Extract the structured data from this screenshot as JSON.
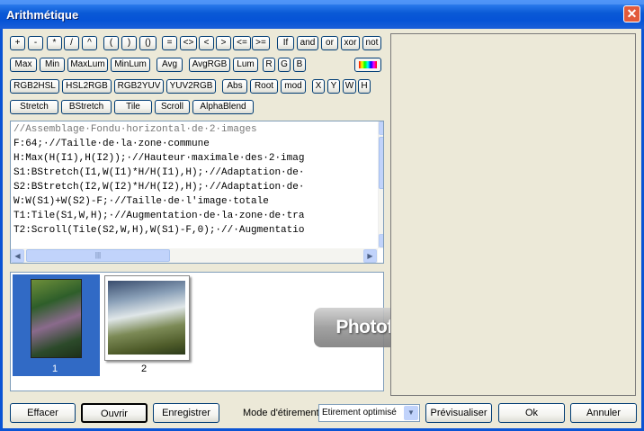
{
  "window": {
    "title": "Arithmétique",
    "close_glyph": "✕"
  },
  "operators_row1": [
    "+",
    "-",
    "*",
    "/",
    "^",
    "(",
    ")",
    "()",
    "=",
    "<>",
    "<",
    ">",
    "<=",
    ">=",
    "If",
    "and",
    "or",
    "xor",
    "not"
  ],
  "functions_row2": [
    "Max",
    "Min",
    "MaxLum",
    "MinLum",
    "Avg",
    "AvgRGB",
    "Lum",
    "R",
    "G",
    "B"
  ],
  "functions_row3": [
    "RGB2HSL",
    "HSL2RGB",
    "RGB2YUV",
    "YUV2RGB",
    "Abs",
    "Root",
    "mod",
    "X",
    "Y",
    "W",
    "H"
  ],
  "functions_row4": [
    "Stretch",
    "BStretch",
    "Tile",
    "Scroll",
    "AlphaBlend"
  ],
  "color_button": {
    "icon": "color-palette-icon"
  },
  "code_lines": [
    "//Assemblage·Fondu·horizontal·de·2·images",
    "F:64;·//Taille·de·la·zone·commune",
    "H:Max(H(I1),H(I2));·//Hauteur·maximale·des·2·imag",
    "S1:BStretch(I1,W(I1)*H/H(I1),H);·//Adaptation·de·",
    "S2:BStretch(I2,W(I2)*H/H(I2),H);·//Adaptation·de·",
    "W:W(S1)+W(S2)-F;·//Taille·de·l'image·totale",
    "T1:Tile(S1,W,H);·//Augmentation·de·la·zone·de·tra",
    "T2:Scroll(Tile(S2,W,H),W(S1)-F,0);·//·Augmentatio"
  ],
  "scroll": {
    "up": "▲",
    "down": "▼",
    "left": "◀",
    "right": "▶",
    "grip": "|||"
  },
  "thumbnails": [
    {
      "label": "1",
      "selected": true
    },
    {
      "label": "2",
      "selected": false
    }
  ],
  "watermark": "PhotofiltreGraphic",
  "bottom": {
    "clear": "Effacer",
    "open": "Ouvrir",
    "save": "Enregistrer",
    "mode_label": "Mode d'étirement",
    "mode_value": "Etirement optimisé",
    "preview": "Prévisualiser",
    "ok": "Ok",
    "cancel": "Annuler"
  }
}
